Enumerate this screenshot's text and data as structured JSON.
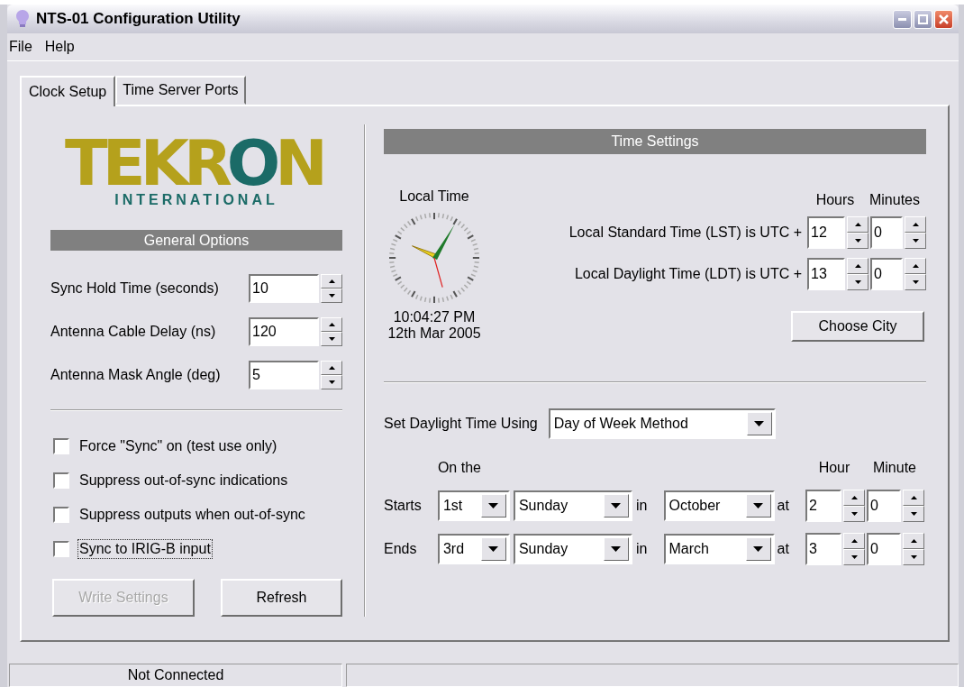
{
  "window": {
    "title": "NTS-01 Configuration Utility"
  },
  "menu": [
    "File",
    "Help"
  ],
  "tabs": [
    {
      "label": "Clock Setup",
      "selected": true
    },
    {
      "label": "Time Server Ports",
      "selected": false
    }
  ],
  "logo": {
    "name": "TEKRON",
    "subtitle": "INTERNATIONAL"
  },
  "general_options": {
    "title": "General Options",
    "fields": [
      {
        "label": "Sync Hold Time (seconds)",
        "value": "10"
      },
      {
        "label": "Antenna Cable Delay (ns)",
        "value": "120"
      },
      {
        "label": "Antenna Mask Angle (deg)",
        "value": "5"
      }
    ],
    "checkboxes": [
      {
        "label": "Force \"Sync\" on (test use only)",
        "checked": false,
        "focused": false
      },
      {
        "label": "Suppress out-of-sync indications",
        "checked": false,
        "focused": false
      },
      {
        "label": "Suppress outputs when out-of-sync",
        "checked": false,
        "focused": false
      },
      {
        "label": "Sync to IRIG-B input",
        "checked": false,
        "focused": true
      }
    ],
    "buttons": [
      {
        "label": "Write Settings",
        "disabled": true
      },
      {
        "label": "Refresh",
        "disabled": false
      }
    ]
  },
  "time_settings": {
    "title": "Time Settings",
    "clock": {
      "label": "Local Time",
      "time": "10:04:27 PM",
      "date": "12th Mar 2005"
    },
    "columns": [
      "Hours",
      "Minutes"
    ],
    "offsets": [
      {
        "label": "Local Standard Time (LST) is UTC +",
        "hours": "12",
        "minutes": "0"
      },
      {
        "label": "Local Daylight Time (LDT) is UTC +",
        "hours": "13",
        "minutes": "0"
      }
    ],
    "choose_city": "Choose City"
  },
  "daylight": {
    "label": "Set Daylight Time Using",
    "method": "Day of Week Method",
    "on_the": "On the",
    "hour_heading": "Hour",
    "minute_heading": "Minute",
    "rules": [
      {
        "label": "Starts",
        "week": "1st",
        "day": "Sunday",
        "in": "in",
        "month": "October",
        "at": "at",
        "hour": "2",
        "minute": "0"
      },
      {
        "label": "Ends",
        "week": "3rd",
        "day": "Sunday",
        "in": "in",
        "month": "March",
        "at": "at",
        "hour": "3",
        "minute": "0"
      }
    ]
  },
  "status_bar": [
    "Not Connected"
  ]
}
